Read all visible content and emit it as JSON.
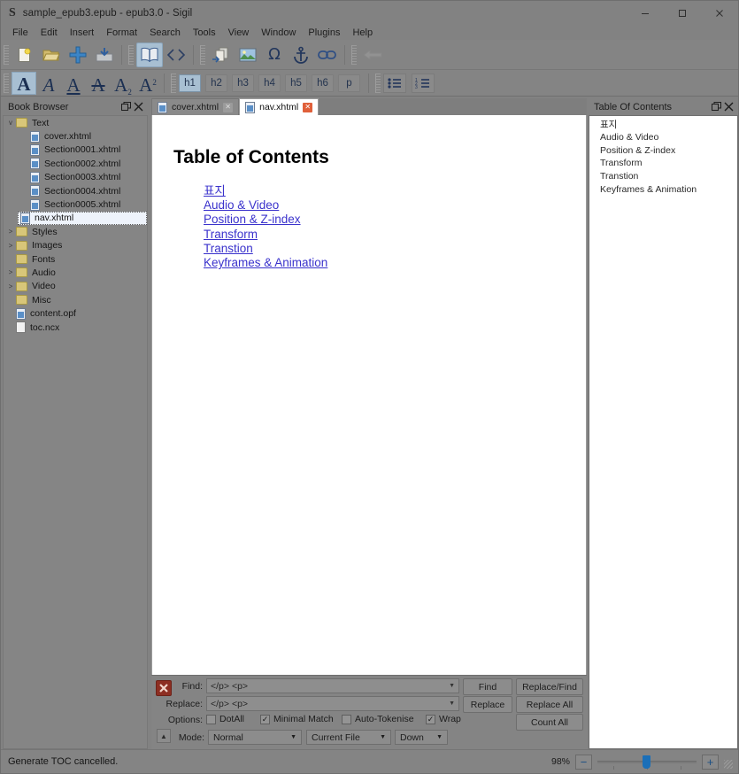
{
  "window": {
    "title": "sample_epub3.epub - epub3.0 - Sigil",
    "logo": "S",
    "controls": {
      "minimize": "minimize-icon",
      "maximize": "maximize-icon",
      "close": "close-icon"
    }
  },
  "menubar": {
    "items": [
      "File",
      "Edit",
      "Insert",
      "Format",
      "Search",
      "Tools",
      "View",
      "Window",
      "Plugins",
      "Help"
    ]
  },
  "toolbar_main": {
    "items": [
      {
        "name": "new-file-icon",
        "checked": false,
        "dim": false
      },
      {
        "name": "open-folder-icon",
        "checked": false,
        "dim": false
      },
      {
        "name": "add-existing-files-icon",
        "checked": false,
        "dim": false
      },
      {
        "name": "save-icon",
        "checked": false,
        "dim": false
      },
      {
        "name": "book-view-icon",
        "checked": true,
        "dim": false
      },
      {
        "name": "code-view-icon",
        "checked": false,
        "dim": false
      },
      {
        "name": "split-file-icon",
        "checked": false,
        "dim": false
      },
      {
        "name": "insert-image-icon",
        "checked": false,
        "dim": false
      },
      {
        "name": "insert-special-character-icon",
        "checked": false,
        "dim": false
      },
      {
        "name": "insert-id-anchor-icon",
        "checked": false,
        "dim": false
      },
      {
        "name": "insert-link-icon",
        "checked": false,
        "dim": false
      },
      {
        "name": "back-arrow-icon",
        "checked": false,
        "dim": true
      }
    ]
  },
  "toolbar_format": {
    "letters": [
      {
        "name": "bold-icon",
        "glyph": "A",
        "checked": true
      },
      {
        "name": "italic-icon",
        "glyph": "A",
        "checked": false
      },
      {
        "name": "underline-icon",
        "glyph": "A",
        "checked": false
      },
      {
        "name": "strikethrough-icon",
        "glyph": "A",
        "checked": false
      },
      {
        "name": "subscript-icon",
        "glyph": "A",
        "checked": false
      },
      {
        "name": "superscript-icon",
        "glyph": "A",
        "checked": false
      }
    ],
    "headings": [
      {
        "label": "h1",
        "checked": true
      },
      {
        "label": "h2",
        "checked": false
      },
      {
        "label": "h3",
        "checked": false
      },
      {
        "label": "h4",
        "checked": false
      },
      {
        "label": "h5",
        "checked": false
      },
      {
        "label": "h6",
        "checked": false
      },
      {
        "label": "p",
        "checked": false
      }
    ],
    "lists": [
      {
        "name": "bullet-list-icon"
      },
      {
        "name": "numbered-list-icon"
      }
    ]
  },
  "book_browser": {
    "title": "Book Browser",
    "float_icon": "float-panel-icon",
    "close_icon": "close-panel-icon",
    "tree": [
      {
        "label": "Text",
        "type": "folder",
        "twisty": "v",
        "indent": 0,
        "selected": false
      },
      {
        "label": "cover.xhtml",
        "type": "xhtml",
        "twisty": "",
        "indent": 1,
        "selected": false
      },
      {
        "label": "Section0001.xhtml",
        "type": "xhtml",
        "twisty": "",
        "indent": 1,
        "selected": false
      },
      {
        "label": "Section0002.xhtml",
        "type": "xhtml",
        "twisty": "",
        "indent": 1,
        "selected": false
      },
      {
        "label": "Section0003.xhtml",
        "type": "xhtml",
        "twisty": "",
        "indent": 1,
        "selected": false
      },
      {
        "label": "Section0004.xhtml",
        "type": "xhtml",
        "twisty": "",
        "indent": 1,
        "selected": false
      },
      {
        "label": "Section0005.xhtml",
        "type": "xhtml",
        "twisty": "",
        "indent": 1,
        "selected": false
      },
      {
        "label": "nav.xhtml",
        "type": "xhtml",
        "twisty": "",
        "indent": 1,
        "selected": true
      },
      {
        "label": "Styles",
        "type": "folder",
        "twisty": ">",
        "indent": 0,
        "selected": false
      },
      {
        "label": "Images",
        "type": "folder",
        "twisty": ">",
        "indent": 0,
        "selected": false
      },
      {
        "label": "Fonts",
        "type": "folder",
        "twisty": "",
        "indent": 0,
        "selected": false
      },
      {
        "label": "Audio",
        "type": "folder",
        "twisty": ">",
        "indent": 0,
        "selected": false
      },
      {
        "label": "Video",
        "type": "folder",
        "twisty": ">",
        "indent": 0,
        "selected": false
      },
      {
        "label": "Misc",
        "type": "folder",
        "twisty": "",
        "indent": 0,
        "selected": false
      },
      {
        "label": "content.opf",
        "type": "xhtml",
        "twisty": "",
        "indent": 0,
        "selected": false
      },
      {
        "label": "toc.ncx",
        "type": "plain",
        "twisty": "",
        "indent": 0,
        "selected": false
      }
    ]
  },
  "toc_panel": {
    "title": "Table Of Contents",
    "float_icon": "float-panel-icon",
    "close_icon": "close-panel-icon",
    "entries": [
      "표지",
      "Audio & Video",
      "Position & Z-index",
      "Transform",
      "Transtion",
      "Keyframes & Animation"
    ]
  },
  "tabs": [
    {
      "label": "cover.xhtml",
      "active": false,
      "close": "✕"
    },
    {
      "label": "nav.xhtml",
      "active": true,
      "close": "✕"
    }
  ],
  "document": {
    "heading": "Table of Contents",
    "links": [
      "표지",
      "Audio & Video",
      "Position & Z-index",
      "Transform",
      "Transtion",
      "Keyframes & Animation"
    ],
    "link_color": "#3a32cc"
  },
  "find_replace": {
    "close_icon": "close-findbar-icon",
    "collapse_icon": "collapse-findbar-icon",
    "find_label": "Find:",
    "find_value": "</p> <p>",
    "replace_label": "Replace:",
    "replace_value": "</p> <p>",
    "options_label": "Options:",
    "options": [
      {
        "label": "DotAll",
        "checked": false
      },
      {
        "label": "Minimal Match",
        "checked": true
      },
      {
        "label": "Auto-Tokenise",
        "checked": false
      },
      {
        "label": "Wrap",
        "checked": true
      }
    ],
    "mode_label": "Mode:",
    "mode_value": "Normal",
    "scope_value": "Current File",
    "direction_value": "Down",
    "buttons": {
      "find": "Find",
      "replace_find": "Replace/Find",
      "replace": "Replace",
      "replace_all": "Replace All",
      "count_all": "Count All"
    }
  },
  "statusbar": {
    "message": "Generate TOC cancelled.",
    "zoom_percent": "98%",
    "zoom_out_icon": "zoom-out-icon",
    "zoom_in_icon": "zoom-in-icon",
    "zoom_out_glyph": "−",
    "zoom_in_glyph": "+"
  }
}
